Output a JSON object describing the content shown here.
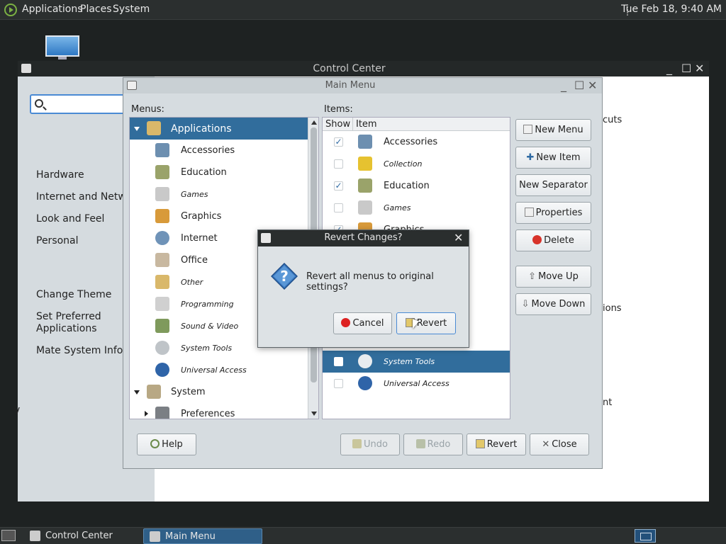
{
  "top_panel": {
    "menus": [
      "Applications",
      "Places",
      "System"
    ],
    "clock": "Tue Feb 18,  9:40 AM"
  },
  "control_center": {
    "title": "Control Center",
    "categories": [
      "Hardware",
      "Internet and Network",
      "Look and Feel",
      "Personal"
    ],
    "groups": [
      "Change Theme",
      "Set Preferred Applications",
      "Mate System Info"
    ],
    "right_fragments": [
      "cuts",
      "ions",
      "nt"
    ],
    "left_fragment": "V"
  },
  "main_menu": {
    "title": "Main Menu",
    "menus_label": "Menus:",
    "items_label": "Items:",
    "menus": [
      {
        "label": "Applications",
        "icon": "applications-icon",
        "italic": false
      },
      {
        "label": "Accessories",
        "icon": "accessories-icon",
        "italic": false
      },
      {
        "label": "Education",
        "icon": "education-icon",
        "italic": false
      },
      {
        "label": "Games",
        "icon": "games-icon",
        "italic": true
      },
      {
        "label": "Graphics",
        "icon": "graphics-icon",
        "italic": false
      },
      {
        "label": "Internet",
        "icon": "internet-icon",
        "italic": false
      },
      {
        "label": "Office",
        "icon": "office-icon",
        "italic": false
      },
      {
        "label": "Other",
        "icon": "other-icon",
        "italic": true
      },
      {
        "label": "Programming",
        "icon": "programming-icon",
        "italic": true
      },
      {
        "label": "Sound & Video",
        "icon": "sound-video-icon",
        "italic": true
      },
      {
        "label": "System Tools",
        "icon": "system-tools-icon",
        "italic": true
      },
      {
        "label": "Universal Access",
        "icon": "universal-access-icon",
        "italic": true
      },
      {
        "label": "System",
        "icon": "system-icon",
        "italic": false
      },
      {
        "label": "Preferences",
        "icon": "preferences-icon",
        "italic": false
      }
    ],
    "items_headers": {
      "show": "Show",
      "item": "Item"
    },
    "items": [
      {
        "label": "Accessories",
        "checked": true,
        "italic": false
      },
      {
        "label": "Collection",
        "checked": false,
        "italic": true
      },
      {
        "label": "Education",
        "checked": true,
        "italic": false
      },
      {
        "label": "Games",
        "checked": false,
        "italic": true
      },
      {
        "label": "Graphics",
        "checked": true,
        "italic": false
      },
      {
        "label": "System Tools",
        "checked": false,
        "italic": true
      },
      {
        "label": "Universal Access",
        "checked": false,
        "italic": true
      }
    ],
    "side_buttons": {
      "new_menu": "New Menu",
      "new_item": "New Item",
      "new_separator": "New Separator",
      "properties": "Properties",
      "delete": "Delete",
      "move_up": "Move Up",
      "move_down": "Move Down"
    },
    "bottom_buttons": {
      "help": "Help",
      "undo": "Undo",
      "redo": "Redo",
      "revert": "Revert",
      "close": "Close"
    }
  },
  "revert_dialog": {
    "title": "Revert Changes?",
    "message": "Revert all menus to original settings?",
    "cancel": "Cancel",
    "revert": "Revert"
  },
  "taskbar": {
    "tasks": [
      "Control Center",
      "Main Menu"
    ],
    "active": "Main Menu"
  },
  "colors": {
    "selection": "#316d9c",
    "panel": "#2b2f2f",
    "dialog_bg": "#d6dce0"
  }
}
